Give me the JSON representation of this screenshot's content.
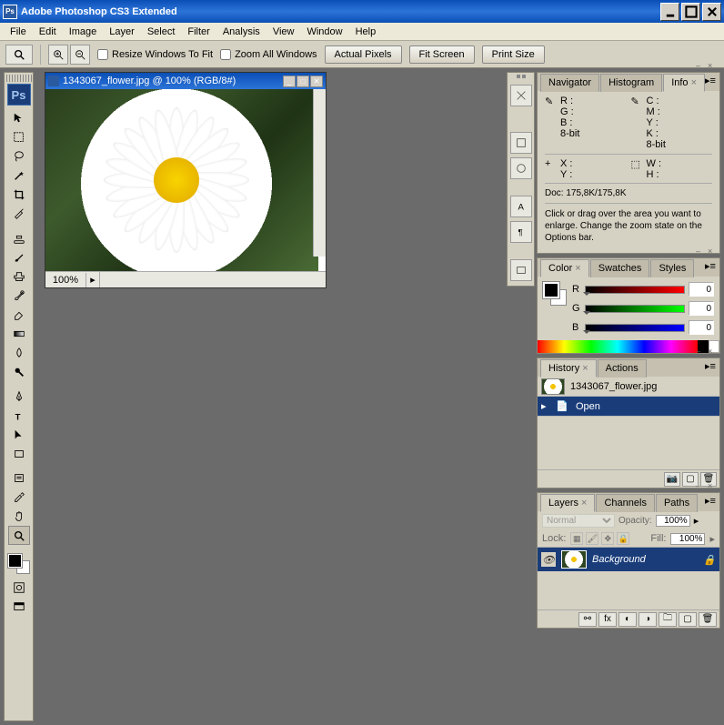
{
  "window": {
    "title": "Adobe Photoshop CS3 Extended"
  },
  "menu": {
    "items": [
      "File",
      "Edit",
      "Image",
      "Layer",
      "Select",
      "Filter",
      "Analysis",
      "View",
      "Window",
      "Help"
    ]
  },
  "options": {
    "resizeWindows": "Resize Windows To Fit",
    "zoomAll": "Zoom All Windows",
    "btn1": "Actual Pixels",
    "btn2": "Fit Screen",
    "btn3": "Print Size"
  },
  "doc": {
    "title": "1343067_flower.jpg @ 100% (RGB/8#)",
    "zoom": "100%"
  },
  "panels": {
    "nav_tabs": [
      "Navigator",
      "Histogram",
      "Info"
    ],
    "info": {
      "r": "R :",
      "g": "G :",
      "b": "B :",
      "bit1": "8-bit",
      "c": "C :",
      "m": "M :",
      "y": "Y :",
      "k": "K :",
      "bit2": "8-bit",
      "x": "X :",
      "ycoord": "Y :",
      "w": "W :",
      "h": "H :",
      "doc": "Doc: 175,8K/175,8K",
      "hint": "Click or drag over the area you want to enlarge. Change the zoom state on the Options bar."
    },
    "color_tabs": [
      "Color",
      "Swatches",
      "Styles"
    ],
    "color": {
      "r_lbl": "R",
      "g_lbl": "G",
      "b_lbl": "B",
      "r": "0",
      "g": "0",
      "b": "0"
    },
    "history_tabs": [
      "History",
      "Actions"
    ],
    "history": {
      "file": "1343067_flower.jpg",
      "step": "Open"
    },
    "layers_tabs": [
      "Layers",
      "Channels",
      "Paths"
    ],
    "layers": {
      "blend": "Normal",
      "opacity_lbl": "Opacity:",
      "opacity": "100%",
      "lock_lbl": "Lock:",
      "fill_lbl": "Fill:",
      "fill": "100%",
      "layer_name": "Background"
    }
  }
}
